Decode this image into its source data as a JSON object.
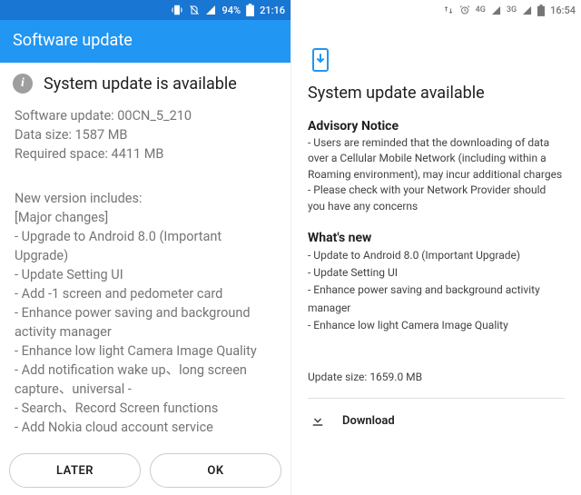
{
  "left": {
    "status": {
      "battery_pct": "94%",
      "time": "21:16"
    },
    "title": "Software update",
    "headline": "System update is available",
    "software_update_label": "Software update:",
    "software_update_value": "00CN_5_210",
    "data_size_label": "Data size:",
    "data_size_value": "1587 MB",
    "required_space_label": "Required space:",
    "required_space_value": "4411 MB",
    "changelog_intro": "New version includes:",
    "changelog_section": "[Major changes]",
    "changelog_items": [
      "- Upgrade to Android 8.0 (Important Upgrade)",
      "- Update Setting UI",
      "- Add -1 screen and pedometer card",
      "- Enhance power saving and background activity manager",
      "- Enhance low light Camera Image Quality",
      "- Add notification wake up、long screen capture、universal -",
      "- Search、Record Screen functions",
      "- Add Nokia cloud account service"
    ],
    "later_label": "LATER",
    "ok_label": "OK"
  },
  "right": {
    "status": {
      "net1": "4G",
      "net2": "3G",
      "time": "16:54"
    },
    "title": "System update available",
    "advisory_title": "Advisory Notice",
    "advisory_body": "- Users are reminded that the downloading of data over a Cellular Mobile Network (including within a Roaming environment), may incur additional charges - Please check with your Network Provider should you have any concerns",
    "whats_new_title": "What's new",
    "whats_new_items": [
      "- Update to Android 8.0 (Important Upgrade)",
      "- Update Setting UI",
      "- Enhance power saving and background activity manager",
      "- Enhance low light Camera Image Quality"
    ],
    "update_size_label": "Update size:",
    "update_size_value": "1659.0 MB",
    "download_label": "Download"
  },
  "colors": {
    "accent_blue": "#2196F3"
  }
}
